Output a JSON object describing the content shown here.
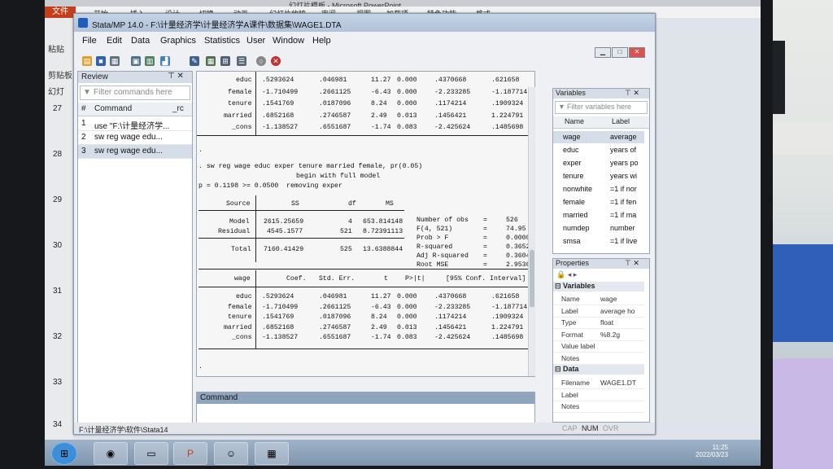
{
  "ppt": {
    "title": "幻灯片模板 - Microsoft PowerPoint",
    "file_btn": "文件",
    "ribbon_tabs": [
      "开始",
      "插入",
      "设计",
      "切换",
      "动画",
      "幻灯片放映",
      "审阅",
      "视图",
      "加载项",
      "特色功能",
      "格式"
    ],
    "left_labels": [
      "粘贴",
      "剪贴板",
      "幻灯"
    ],
    "slide_numbers": [
      "27",
      "28",
      "29",
      "30",
      "31",
      "32",
      "33",
      "34"
    ]
  },
  "stata": {
    "title": "Stata/MP 14.0 - F:\\计量经济学\\计量经济学A课件\\数据集\\WAGE1.DTA",
    "menu": [
      "File",
      "Edit",
      "Data",
      "Graphics",
      "Statistics",
      "User",
      "Window",
      "Help"
    ]
  },
  "review": {
    "header": "Review",
    "filter_placeholder": "Filter commands here",
    "col_num": "#",
    "col_command": "Command",
    "col_rc": "_rc",
    "items": [
      {
        "num": "1",
        "command": "use \"F:\\计量经济学..."
      },
      {
        "num": "2",
        "command": "sw reg wage edu..."
      },
      {
        "num": "3",
        "command": "sw reg wage edu..."
      }
    ]
  },
  "results": {
    "top_rows": [
      {
        "var": "educ",
        "coef": ".5293624",
        "se": ".046981",
        "t": "11.27",
        "p": "0.000",
        "lo": ".4370668",
        "hi": ".621658"
      },
      {
        "var": "female",
        "coef": "-1.710499",
        "se": ".2661125",
        "t": "-6.43",
        "p": "0.000",
        "lo": "-2.233285",
        "hi": "-1.187714"
      },
      {
        "var": "tenure",
        "coef": ".1541769",
        "se": ".0187096",
        "t": "8.24",
        "p": "0.000",
        "lo": ".1174214",
        "hi": ".1909324"
      },
      {
        "var": "married",
        "coef": ".6852168",
        "se": ".2746587",
        "t": "2.49",
        "p": "0.013",
        "lo": ".1456421",
        "hi": "1.224791"
      },
      {
        "var": "_cons",
        "coef": "-1.138527",
        "se": ".6551687",
        "t": "-1.74",
        "p": "0.083",
        "lo": "-2.425624",
        "hi": ".1485698"
      }
    ],
    "dot1": ".",
    "command": ". sw reg wage educ exper tenure married female, pr(0.05)",
    "begin": "begin with full model",
    "removing": "p = 0.1198 >= 0.0500  removing exper",
    "anova_head": {
      "source": "Source",
      "ss": "SS",
      "df": "df",
      "ms": "MS"
    },
    "anova_rows": [
      {
        "source": "Model",
        "ss": "2615.25659",
        "df": "4",
        "ms": "653.814148"
      },
      {
        "source": "Residual",
        "ss": "4545.1577",
        "df": "521",
        "ms": "8.72391113"
      },
      {
        "source": "Total",
        "ss": "7160.41429",
        "df": "525",
        "ms": "13.6388844"
      }
    ],
    "stats": [
      {
        "label": "Number of obs",
        "eq": "=",
        "val": "526"
      },
      {
        "label": "F(4, 521)",
        "eq": "=",
        "val": "74.95"
      },
      {
        "label": "Prob > F",
        "eq": "=",
        "val": "0.0000"
      },
      {
        "label": "R-squared",
        "eq": "=",
        "val": "0.3652"
      },
      {
        "label": "Adj R-squared",
        "eq": "=",
        "val": "0.3604"
      },
      {
        "label": "Root MSE",
        "eq": "=",
        "val": "2.9536"
      }
    ],
    "coef_head": {
      "var": "wage",
      "coef": "Coef.",
      "se": "Std. Err.",
      "t": "t",
      "p": "P>|t|",
      "ci": "[95% Conf. Interval]"
    },
    "coef_rows": [
      {
        "var": "educ",
        "coef": ".5293624",
        "se": ".046981",
        "t": "11.27",
        "p": "0.000",
        "lo": ".4370668",
        "hi": ".621658"
      },
      {
        "var": "female",
        "coef": "-1.710499",
        "se": ".2661125",
        "t": "-6.43",
        "p": "0.000",
        "lo": "-2.233285",
        "hi": "-1.187714"
      },
      {
        "var": "tenure",
        "coef": ".1541769",
        "se": ".0187096",
        "t": "8.24",
        "p": "0.000",
        "lo": ".1174214",
        "hi": ".1909324"
      },
      {
        "var": "married",
        "coef": ".6852168",
        "se": ".2746587",
        "t": "2.49",
        "p": "0.013",
        "lo": ".1456421",
        "hi": "1.224791"
      },
      {
        "var": "_cons",
        "coef": "-1.138527",
        "se": ".6551687",
        "t": "-1.74",
        "p": "0.083",
        "lo": "-2.425624",
        "hi": ".1485698"
      }
    ],
    "dot2": "."
  },
  "command_pane": {
    "header": "Command"
  },
  "variables": {
    "header": "Variables",
    "filter_placeholder": "Filter variables here",
    "col_name": "Name",
    "col_label": "Label",
    "rows": [
      {
        "name": "wage",
        "label": "average"
      },
      {
        "name": "educ",
        "label": "years of"
      },
      {
        "name": "exper",
        "label": "years po"
      },
      {
        "name": "tenure",
        "label": "years wi"
      },
      {
        "name": "nonwhite",
        "label": "=1 if nor"
      },
      {
        "name": "female",
        "label": "=1 if fen"
      },
      {
        "name": "married",
        "label": "=1 if ma"
      },
      {
        "name": "numdep",
        "label": "number"
      },
      {
        "name": "smsa",
        "label": "=1 if live"
      }
    ]
  },
  "properties": {
    "header": "Properties",
    "variables_section": "Variables",
    "var_props": [
      {
        "k": "Name",
        "v": "wage"
      },
      {
        "k": "Label",
        "v": "average ho"
      },
      {
        "k": "Type",
        "v": "float"
      },
      {
        "k": "Format",
        "v": "%8.2g"
      },
      {
        "k": "Value label",
        "v": ""
      },
      {
        "k": "Notes",
        "v": ""
      }
    ],
    "data_section": "Data",
    "data_props": [
      {
        "k": "Filename",
        "v": "WAGE1.DT"
      },
      {
        "k": "Label",
        "v": ""
      },
      {
        "k": "Notes",
        "v": ""
      }
    ]
  },
  "statusbar": {
    "path": "F:\\计量经济学\\软件\\Stata14",
    "cap": "CAP",
    "num": "NUM",
    "ovr": "OVR"
  },
  "clock": {
    "time": "11:25",
    "date": "2022/03/23"
  }
}
